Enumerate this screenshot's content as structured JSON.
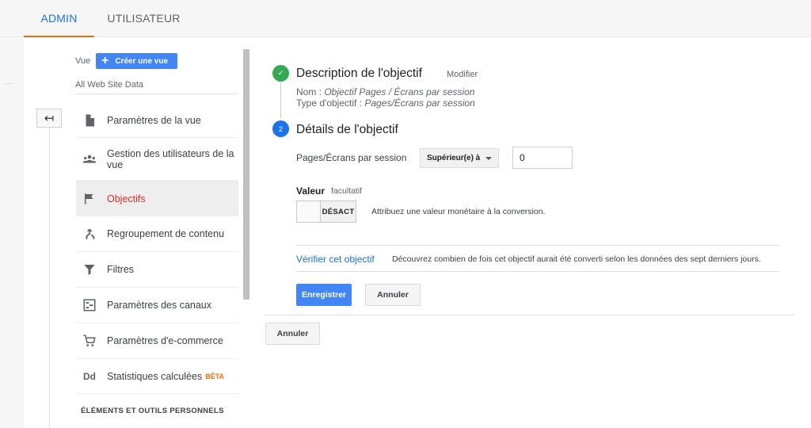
{
  "tabs": {
    "admin": "ADMIN",
    "user": "UTILISATEUR"
  },
  "view": {
    "label": "Vue",
    "create_button": "Créer une vue",
    "name": "All Web Site Data"
  },
  "nav": {
    "items": [
      {
        "label": "Paramètres de la vue",
        "icon": "document-icon"
      },
      {
        "label": "Gestion des utilisateurs de la vue",
        "icon": "users-icon"
      },
      {
        "label": "Objectifs",
        "icon": "flag-icon",
        "active": true
      },
      {
        "label": "Regroupement de contenu",
        "icon": "merge-icon"
      },
      {
        "label": "Filtres",
        "icon": "filter-icon"
      },
      {
        "label": "Paramètres des canaux",
        "icon": "channels-icon"
      },
      {
        "label": "Paramètres d'e-commerce",
        "icon": "cart-icon"
      },
      {
        "label": "Statistiques calculées",
        "icon": "dd-icon",
        "badge": "BÊTA"
      }
    ],
    "section_header": "ÉLÉMENTS ET OUTILS PERSONNELS"
  },
  "goal": {
    "step1": {
      "number": "✓",
      "title": "Description de l'objectif",
      "modify": "Modifier",
      "name_label": "Nom : ",
      "name_value": "Objectif Pages / Écrans par session",
      "type_label": "Type d'objectif : ",
      "type_value": "Pages/Écrans par session"
    },
    "step2": {
      "number": "2",
      "title": "Détails de l'objectif",
      "field_label": "Pages/Écrans par session",
      "comparator": "Supérieur(e) à",
      "value": "0",
      "valeur_label": "Valeur",
      "optional": "facultatif",
      "toggle_state": "DÉSACT",
      "toggle_desc": "Attribuez une valeur monétaire à la conversion.",
      "verify_link": "Vérifier cet objectif",
      "verify_desc": "Découvrez combien de fois cet objectif aurait été converti selon les données des sept derniers jours.",
      "save": "Enregistrer",
      "cancel": "Annuler"
    },
    "cancel_all": "Annuler"
  },
  "colors": {
    "accent_blue": "#4285f4",
    "link_blue": "#1a73e8",
    "active_orange": "#e8710a",
    "success_green": "#34a853",
    "active_red": "#d93025"
  }
}
